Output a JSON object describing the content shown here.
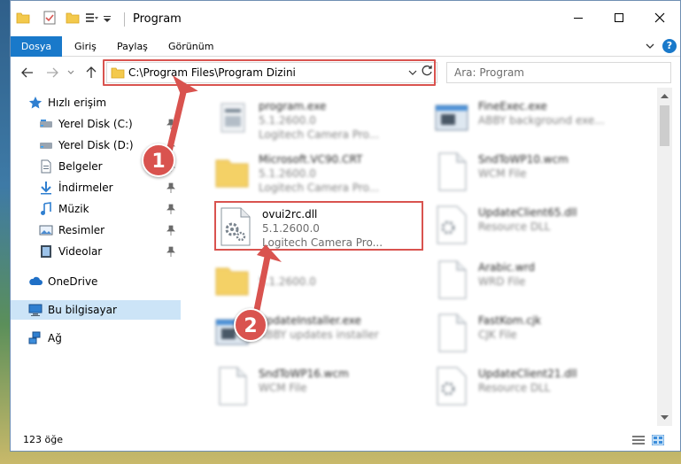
{
  "window": {
    "title": "Program",
    "controls": {
      "minimize": "minimize",
      "maximize": "maximize",
      "close": "close"
    }
  },
  "ribbon": {
    "tabs": [
      {
        "label": "Dosya",
        "active": true
      },
      {
        "label": "Giriş",
        "active": false
      },
      {
        "label": "Paylaş",
        "active": false
      },
      {
        "label": "Görünüm",
        "active": false
      }
    ],
    "help_label": "?"
  },
  "address": {
    "path": "C:\\Program Files\\Program Dizini",
    "search_placeholder": "Ara: Program"
  },
  "nav": {
    "items": [
      {
        "label": "Hızlı erişim",
        "icon": "star-icon",
        "pinned": false
      },
      {
        "label": "Yerel Disk (C:)",
        "icon": "drive-icon",
        "pinned": true
      },
      {
        "label": "Yerel Disk (D:)",
        "icon": "drive-icon",
        "pinned": true
      },
      {
        "label": "Belgeler",
        "icon": "document-icon",
        "pinned": true
      },
      {
        "label": "İndirmeler",
        "icon": "download-icon",
        "pinned": true
      },
      {
        "label": "Müzik",
        "icon": "music-icon",
        "pinned": true
      },
      {
        "label": "Resimler",
        "icon": "picture-icon",
        "pinned": true
      },
      {
        "label": "Videolar",
        "icon": "video-icon",
        "pinned": true
      },
      {
        "label": "OneDrive",
        "icon": "cloud-icon",
        "pinned": false
      },
      {
        "label": "Bu bilgisayar",
        "icon": "computer-icon",
        "pinned": false,
        "selected": true
      },
      {
        "label": "Ağ",
        "icon": "network-icon",
        "pinned": false
      }
    ]
  },
  "files": [
    {
      "name": "program.exe",
      "line1": "5.1.2600.0",
      "line2": "Logitech Camera Pro...",
      "icon": "exe-icon"
    },
    {
      "name": "FineExec.exe",
      "line1": "ABBY background exe...",
      "line2": "",
      "icon": "window-icon"
    },
    {
      "name": "Microsoft.VC90.CRT",
      "line1": "5.1.2600.0",
      "line2": "Logitech Camera Pro...",
      "icon": "folder-icon"
    },
    {
      "name": "SndToWP10.wcm",
      "line1": "WCM File",
      "line2": "",
      "icon": "blank-file-icon"
    },
    {
      "name": "ovui2rc.dll",
      "line1": "5.1.2600.0",
      "line2": "Logitech Camera Pro...",
      "icon": "dll-gear-icon"
    },
    {
      "name": "UpdateClient65.dll",
      "line1": "Resource DLL",
      "line2": "",
      "icon": "dll-gear-icon"
    },
    {
      "name": "",
      "line1": "5.1.2600.0",
      "line2": "",
      "icon": "folder-icon"
    },
    {
      "name": "Arabic.wrd",
      "line1": "WRD File",
      "line2": "",
      "icon": "blank-file-icon"
    },
    {
      "name": "UpdateInstaller.exe",
      "line1": "ABBY updates installer",
      "line2": "",
      "icon": "window-icon"
    },
    {
      "name": "FastKom.cjk",
      "line1": "CJK File",
      "line2": "",
      "icon": "blank-file-icon"
    },
    {
      "name": "SndToWP16.wcm",
      "line1": "WCM File",
      "line2": "",
      "icon": "blank-file-icon"
    },
    {
      "name": "UpdateClient21.dll",
      "line1": "Resource DLL",
      "line2": "",
      "icon": "dll-gear-icon"
    }
  ],
  "status": {
    "count": "123 öğe"
  },
  "callouts": {
    "one": "1",
    "two": "2"
  },
  "colors": {
    "accent": "#1979ca",
    "highlight": "#d9534f",
    "selected": "#cce4f7"
  }
}
